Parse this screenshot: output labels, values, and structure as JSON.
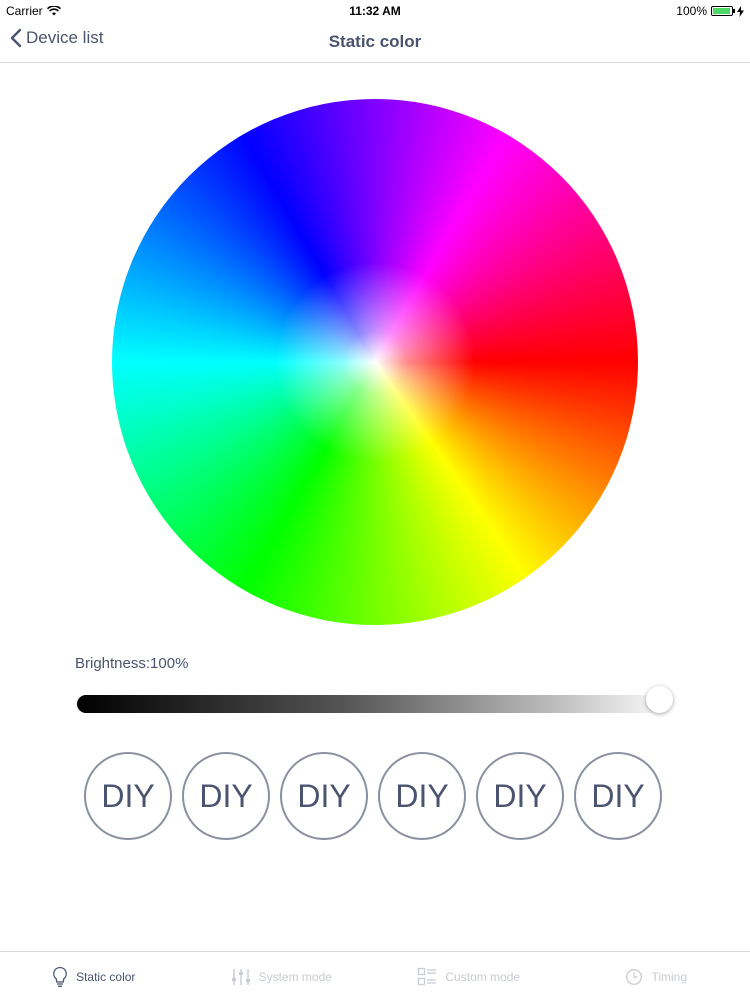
{
  "status_bar": {
    "carrier": "Carrier",
    "time": "11:32 AM",
    "battery": "100%"
  },
  "nav": {
    "back_label": "Device list",
    "title": "Static color"
  },
  "brightness": {
    "label": "Brightness:100%",
    "value": 1.0
  },
  "diy_buttons": [
    "DIY",
    "DIY",
    "DIY",
    "DIY",
    "DIY",
    "DIY"
  ],
  "tabs": [
    {
      "label": "Static color",
      "icon": "bulb-icon",
      "active": true
    },
    {
      "label": "System mode",
      "icon": "sliders-icon",
      "active": false
    },
    {
      "label": "Custom mode",
      "icon": "list-grid-icon",
      "active": false
    },
    {
      "label": "Timing",
      "icon": "clock-icon",
      "active": false
    }
  ],
  "colors": {
    "text": "#4a5470",
    "inactive_tab": "#c8cbd4",
    "battery_fill": "#4cd964"
  }
}
